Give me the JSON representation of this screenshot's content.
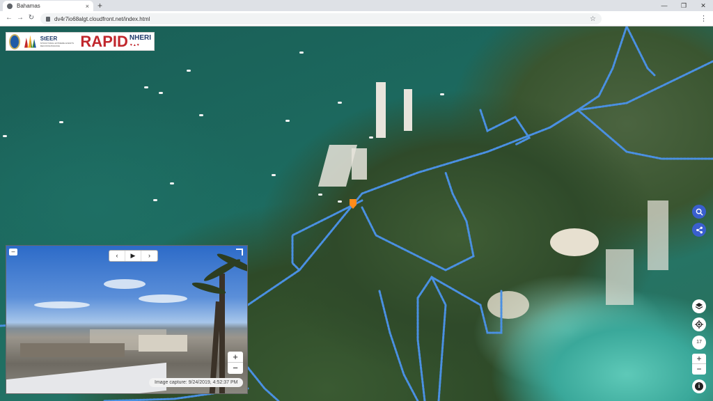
{
  "browser": {
    "tab_title": "Bahamas",
    "tab_close": "×",
    "new_tab": "+",
    "url": "dv4r7io68algt.cloudfront.net/index.html",
    "back": "←",
    "forward": "→",
    "reload": "↻",
    "star": "☆",
    "menu": "⋮",
    "minimize": "—",
    "maximize": "❐",
    "close": "✕"
  },
  "logo": {
    "steer": "StEER",
    "steer_sub": "STRUCTURAL EXTREME EVENTS RECONNAISSANCE",
    "rapid": "RAPID",
    "nheri": "NHERI"
  },
  "street_view": {
    "collapse_label": "–",
    "prev_label": "‹",
    "play_label": "▶",
    "next_label": "›",
    "zoom_in": "+",
    "zoom_out": "−",
    "caption": "Image capture: 9/24/2019, 4:52:37 PM"
  },
  "map_controls": {
    "search_icon": "search-icon",
    "share_icon": "share-icon",
    "layers_icon": "layers-icon",
    "locate_icon": "locate-icon",
    "zoom_level": "17",
    "zoom_in": "+",
    "zoom_out": "−",
    "info": "i"
  },
  "colors": {
    "route": "#4a90e2",
    "accent_blue": "#3a5fcf",
    "marker": "#ff8c1a"
  }
}
